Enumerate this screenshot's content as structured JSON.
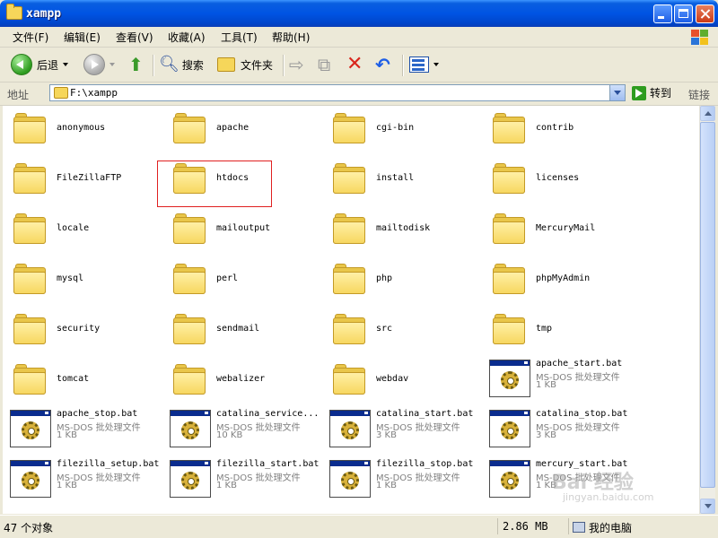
{
  "window": {
    "title": "xampp"
  },
  "menu": [
    "文件(F)",
    "编辑(E)",
    "查看(V)",
    "收藏(A)",
    "工具(T)",
    "帮助(H)"
  ],
  "toolbar": {
    "back": "后退",
    "search": "搜索",
    "folders": "文件夹",
    "go": "转到"
  },
  "address": {
    "label": "地址",
    "path": "F:\\xampp",
    "links": "链接"
  },
  "folders": [
    "anonymous",
    "apache",
    "cgi-bin",
    "contrib",
    "FileZillaFTP",
    "htdocs",
    "install",
    "licenses",
    "locale",
    "mailoutput",
    "mailtodisk",
    "MercuryMail",
    "mysql",
    "perl",
    "php",
    "phpMyAdmin",
    "security",
    "sendmail",
    "src",
    "tmp",
    "tomcat",
    "webalizer",
    "webdav"
  ],
  "files": [
    {
      "name": "apache_start.bat",
      "type": "MS-DOS 批处理文件",
      "size": "1 KB"
    },
    {
      "name": "apache_stop.bat",
      "type": "MS-DOS 批处理文件",
      "size": "1 KB"
    },
    {
      "name": "catalina_service...",
      "type": "MS-DOS 批处理文件",
      "size": "10 KB"
    },
    {
      "name": "catalina_start.bat",
      "type": "MS-DOS 批处理文件",
      "size": "3 KB"
    },
    {
      "name": "catalina_stop.bat",
      "type": "MS-DOS 批处理文件",
      "size": "3 KB"
    },
    {
      "name": "filezilla_setup.bat",
      "type": "MS-DOS 批处理文件",
      "size": "1 KB"
    },
    {
      "name": "filezilla_start.bat",
      "type": "MS-DOS 批处理文件",
      "size": "1 KB"
    },
    {
      "name": "filezilla_stop.bat",
      "type": "MS-DOS 批处理文件",
      "size": "1 KB"
    },
    {
      "name": "mercury_start.bat",
      "type": "MS-DOS 批处理文件",
      "size": "1 KB"
    }
  ],
  "status": {
    "count": "47 个对象",
    "size": "2.86 MB",
    "location": "我的电脑"
  },
  "watermark": {
    "brand": "Bai 经验",
    "url": "jingyan.baidu.com"
  },
  "colors": {
    "titlebar": "#0054e3",
    "highlight": "#e02020",
    "folder": "#f7d760"
  }
}
